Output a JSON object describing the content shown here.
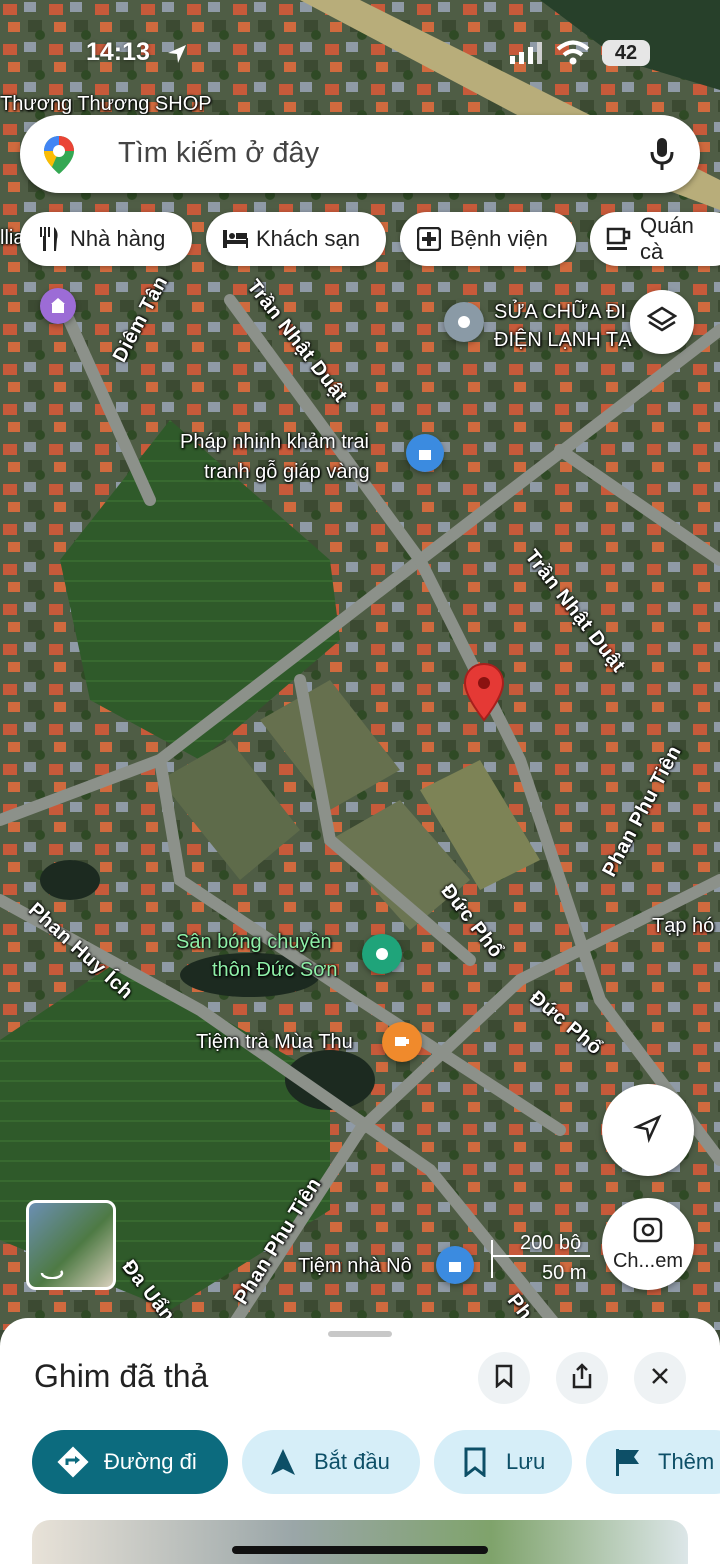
{
  "status_bar": {
    "time": "14:13",
    "battery": "42"
  },
  "search": {
    "placeholder": "Tìm kiếm ở đây"
  },
  "chips": [
    {
      "label": "Nhà hàng",
      "icon": "restaurant-icon"
    },
    {
      "label": "Khách sạn",
      "icon": "hotel-icon"
    },
    {
      "label": "Bệnh viện",
      "icon": "hospital-icon"
    },
    {
      "label": "Quán cà",
      "icon": "coffee-icon"
    }
  ],
  "map": {
    "streets": {
      "diem_tan": "Diêm Tân",
      "tran_nhat_duat_1": "Trần Nhật Duật",
      "tran_nhat_duat_2": "Trần Nhật Duật",
      "phan_phu_tien_1": "Phan Phu Tiên",
      "phan_phu_tien_2": "Phan Phu Tiên",
      "duc_pho_1": "Đức Phổ",
      "duc_pho_2": "Đức Phổ",
      "phan_huy_ich": "Phan Huy Ích",
      "da_uan": "Đa Uẩn",
      "ph_cut": "Ph"
    },
    "pois": {
      "shop": "Thương Thương SHOP",
      "repair_1": "SỬA CHỮA ĐI",
      "repair_2": "ĐIỆN LẠNH TẠ",
      "phap_1": "Pháp nhinh khảm trai",
      "phap_2": "tranh gỗ giáp vàng",
      "san_bong_1": "Sân bóng chuyền",
      "san_bong_2": "thôn Đức Sơn",
      "tiem_tra": "Tiệm trà Mùa Thu",
      "tiem_nha_no": "Tiệm nhà Nô",
      "tap_hoa": "Tạp hó",
      "left_cut": "llia"
    },
    "scale": {
      "top": "200 bộ",
      "bottom": "50 m"
    },
    "lens_label": "Ch...em"
  },
  "sheet": {
    "title": "Ghim đã thả",
    "actions": [
      {
        "label": "Đường đi",
        "icon": "directions-icon"
      },
      {
        "label": "Bắt đầu",
        "icon": "navigate-arrow-icon"
      },
      {
        "label": "Lưu",
        "icon": "bookmark-icon"
      },
      {
        "label": "Thêm",
        "icon": "flag-icon"
      }
    ]
  },
  "colors": {
    "primary": "#0c6b7e",
    "secondary": "#d6eef8",
    "pin": "#e53935"
  }
}
